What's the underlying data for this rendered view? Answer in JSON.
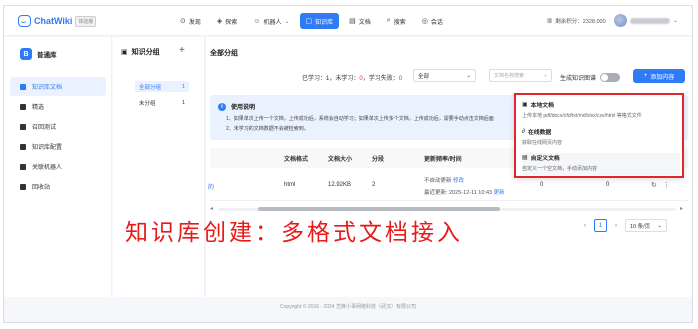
{
  "header": {
    "logo_text": "ChatWiki",
    "trial_badge": "体验版",
    "nav": [
      {
        "label": "发现",
        "icon": "compass-icon",
        "glyph": "⊙"
      },
      {
        "label": "探索",
        "icon": "explore-icon",
        "glyph": "◈"
      },
      {
        "label": "机器人",
        "icon": "robot-icon",
        "glyph": "☺"
      },
      {
        "label": "知识库",
        "icon": "knowledge-base-icon",
        "glyph": "▢",
        "active": true
      },
      {
        "label": "文档",
        "icon": "document-icon",
        "glyph": "▤"
      },
      {
        "label": "搜索",
        "icon": "search-icon",
        "glyph": "⌕"
      },
      {
        "label": "会话",
        "icon": "chat-icon",
        "glyph": "◎"
      }
    ],
    "points_label": "剩余积分：2328.000"
  },
  "sidebar": {
    "kb_icon_letter": "B",
    "kb_name": "普通库",
    "items": [
      {
        "label": "知识库文档",
        "active": true
      },
      {
        "label": "精选"
      },
      {
        "label": "召回测试"
      },
      {
        "label": "知识库配置"
      },
      {
        "label": "关联机器人"
      },
      {
        "label": "回收站"
      }
    ]
  },
  "groups": {
    "title": "知识分组",
    "add_glyph": "+",
    "items": [
      {
        "label": "全部分组",
        "count": "1",
        "active": true
      },
      {
        "label": "未分组",
        "count": "1"
      }
    ]
  },
  "main": {
    "title": "全部分组",
    "stats_prefix": "已学习：1，未学习：",
    "stats_unlearned": "0",
    "stats_mid": "，学习失败：",
    "stats_failed": "0",
    "filter_value": "全部",
    "search_placeholder": "文档名称搜索",
    "graph_toggle_label": "生成知识图谱",
    "add_button_label": "添加内容",
    "notice_title": "使用说明",
    "notice_line1": "1、如果单次上传一个文档，上传成功后，系统会自动学习；如果单次上传多个文档，上传成功后，需要手动点击文档后面",
    "notice_line2": "2、未学习的文档数据不会被检索到。",
    "columns": [
      "文档格式",
      "文档大小",
      "分段",
      "更新频率/时间"
    ],
    "row": {
      "name_fragment": "的",
      "format": "html",
      "size": "12.92KB",
      "segments": "2",
      "update_status": "不自动更新",
      "modify_link": "修改",
      "latest_update": "最近更新: 2025-12-11 10:43",
      "update_link": "更新",
      "col_a": "0",
      "col_b": "0"
    },
    "pagination": {
      "current": "1",
      "page_size": "10 条/页"
    }
  },
  "dropdown": {
    "items": [
      {
        "title": "本地文档",
        "desc": "上传本地 pdf/docx/ofd/txt/md/xlsx/csv/html 等格式文件"
      },
      {
        "title": "在线数据",
        "desc": "获取在线网页内容"
      },
      {
        "title": "自定义文档",
        "desc": "自定义一个空文档，手动添加内容"
      }
    ]
  },
  "caption": "知识库创建：多格式文档接入",
  "footer": "Copyright © 2016 - 2024 芝麻小事网络科技（武汉）有限公司",
  "colors": {
    "accent": "#2f7bf6",
    "highlight_border": "#e0262e",
    "caption": "#e81a1a"
  }
}
